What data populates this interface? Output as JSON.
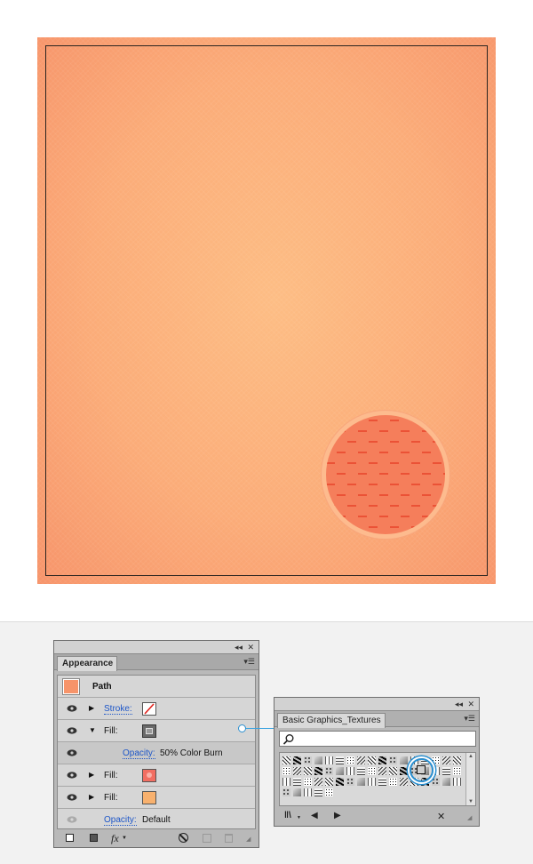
{
  "appearance_panel": {
    "title": "Appearance",
    "collapse_glyph": "◂◂",
    "close_glyph": "✕",
    "menu_glyph": "▾☰",
    "object_label": "Path",
    "rows": [
      {
        "label": "Stroke:",
        "swatch": "none-slash"
      },
      {
        "label": "Fill:",
        "swatch": "dark-texture",
        "expanded": true
      },
      {
        "label": "Opacity:",
        "value": "50% Color Burn"
      },
      {
        "label": "Fill:",
        "swatch": "red-pattern"
      },
      {
        "label": "Fill:",
        "swatch": "orange"
      },
      {
        "label": "Opacity:",
        "value": "Default"
      }
    ],
    "footer_icons": [
      "new-stroke-icon",
      "new-fill-icon",
      "fx-icon",
      "clear-icon",
      "duplicate-icon",
      "delete-icon"
    ],
    "fx_label": "fx"
  },
  "swatches_panel": {
    "title": "Basic Graphics_Textures",
    "collapse_glyph": "◂◂",
    "close_glyph": "✕",
    "menu_glyph": "▾☰",
    "search_placeholder": "",
    "footer_icons": [
      "library-menu-icon",
      "previous-library-icon",
      "next-library-icon",
      "swatch-tool-icon"
    ]
  },
  "colors": {
    "artboard": "#fbac78",
    "object_swatch": "#f7946a",
    "link_blue": "#1d56c8",
    "connector": "#3aa3e0",
    "magnifier_fill": "#f57e5b",
    "dash": "#e8442a"
  }
}
